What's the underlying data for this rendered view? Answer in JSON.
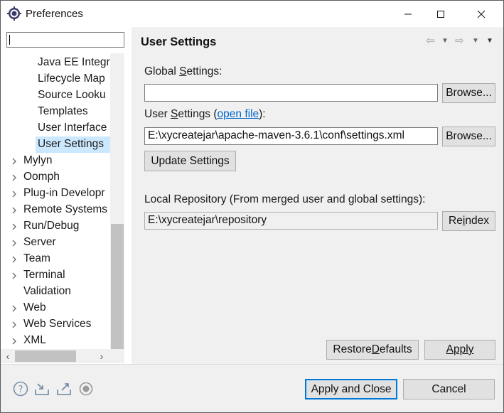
{
  "window": {
    "title": "Preferences"
  },
  "filter": {
    "value": "",
    "placeholder": ""
  },
  "tree": {
    "items": [
      {
        "label": "Java EE Integra",
        "level": "child",
        "expandable": false,
        "selected": false
      },
      {
        "label": "Lifecycle Map",
        "level": "child",
        "expandable": false,
        "selected": false
      },
      {
        "label": "Source Looku",
        "level": "child",
        "expandable": false,
        "selected": false
      },
      {
        "label": "Templates",
        "level": "child",
        "expandable": false,
        "selected": false
      },
      {
        "label": "User Interface",
        "level": "child",
        "expandable": false,
        "selected": false
      },
      {
        "label": "User Settings",
        "level": "child",
        "expandable": false,
        "selected": true
      },
      {
        "label": "Mylyn",
        "level": "root",
        "expandable": true,
        "selected": false
      },
      {
        "label": "Oomph",
        "level": "root",
        "expandable": true,
        "selected": false
      },
      {
        "label": "Plug-in Developr",
        "level": "root",
        "expandable": true,
        "selected": false
      },
      {
        "label": "Remote Systems",
        "level": "root",
        "expandable": true,
        "selected": false
      },
      {
        "label": "Run/Debug",
        "level": "root",
        "expandable": true,
        "selected": false
      },
      {
        "label": "Server",
        "level": "root",
        "expandable": true,
        "selected": false
      },
      {
        "label": "Team",
        "level": "root",
        "expandable": true,
        "selected": false
      },
      {
        "label": "Terminal",
        "level": "root",
        "expandable": true,
        "selected": false
      },
      {
        "label": "Validation",
        "level": "root",
        "expandable": false,
        "selected": false
      },
      {
        "label": "Web",
        "level": "root",
        "expandable": true,
        "selected": false
      },
      {
        "label": "Web Services",
        "level": "root",
        "expandable": true,
        "selected": false
      },
      {
        "label": "XML",
        "level": "root",
        "expandable": true,
        "selected": false
      }
    ]
  },
  "page": {
    "title": "User Settings",
    "global_label_pre": "Global ",
    "global_label_u": "S",
    "global_label_post": "ettings:",
    "global_value": "",
    "user_label_pre": "User ",
    "user_label_u": "S",
    "user_label_mid": "ettings (",
    "user_link": "open file",
    "user_label_post": "):",
    "user_value": "E:\\xycreatejar\\apache-maven-3.6.1\\conf\\settings.xml",
    "browse_label": "Browse...",
    "update_button": "Update Settings",
    "local_label": "Local Repository (From merged user and global settings):",
    "local_value": "E:\\xycreatejar\\repository",
    "reindex_pre": "Re",
    "reindex_u": "i",
    "reindex_post": "ndex",
    "restore_pre": "Restore ",
    "restore_u": "D",
    "restore_post": "efaults",
    "apply_label": "Apply"
  },
  "footer": {
    "apply_close": "Apply and Close",
    "cancel": "Cancel"
  },
  "colors": {
    "selection": "#cce8ff",
    "link": "#0066cc",
    "default_button_border": "#0078d7"
  }
}
